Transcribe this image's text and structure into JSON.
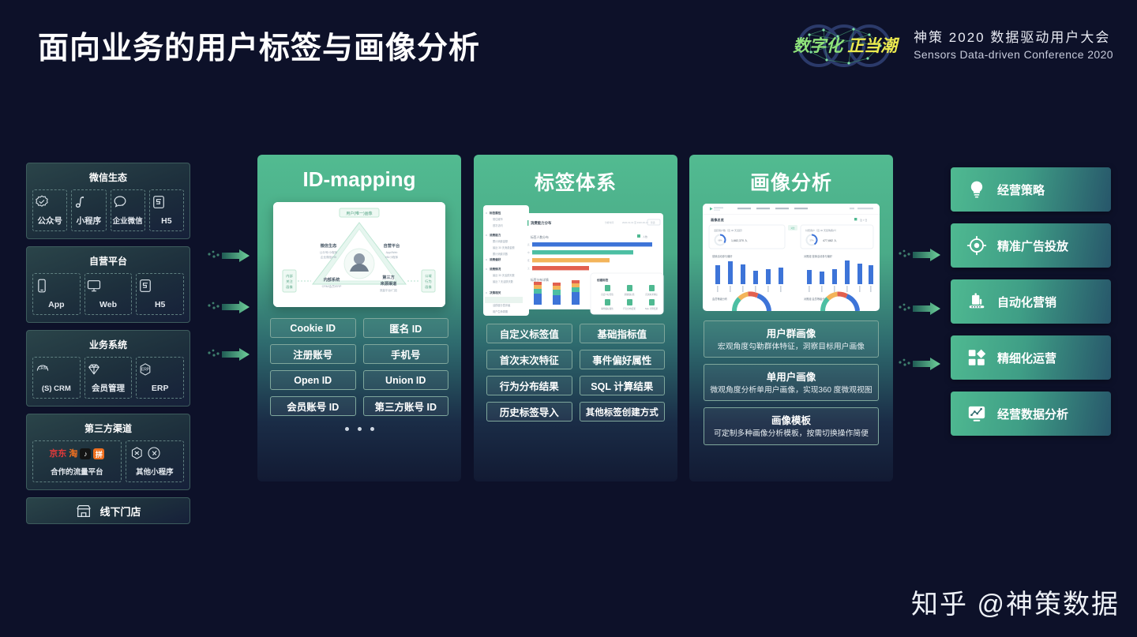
{
  "header": {
    "title": "面向业务的用户标签与画像分析",
    "brand": {
      "slogan_1": "数字化",
      "slogan_2": "正当潮",
      "conference_cn": "神策 2020 数据驱动用户大会",
      "conference_en": "Sensors Data-driven Conference 2020",
      "slogan_1_color": "#8fe37a",
      "slogan_2_color": "#ecea4e"
    }
  },
  "sources": {
    "groups": [
      {
        "title": "微信生态",
        "items": [
          {
            "label": "公众号",
            "icon": "verified-badge-icon"
          },
          {
            "label": "小程序",
            "icon": "mini-program-icon"
          },
          {
            "label": "企业微信",
            "icon": "chat-bubble-icon"
          },
          {
            "label": "H5",
            "icon": "html5-icon"
          }
        ]
      },
      {
        "title": "自营平台",
        "items": [
          {
            "label": "App",
            "icon": "mobile-phone-icon"
          },
          {
            "label": "Web",
            "icon": "desktop-monitor-icon"
          },
          {
            "label": "H5",
            "icon": "html5-icon"
          }
        ]
      },
      {
        "title": "业务系统",
        "items": [
          {
            "label": "(S) CRM",
            "icon": "crm-icon"
          },
          {
            "label": "会员管理",
            "icon": "diamond-icon"
          },
          {
            "label": "ERP",
            "icon": "erp-icon"
          }
        ]
      },
      {
        "title": "第三方渠道",
        "items": [
          {
            "label": "合作的流量平台",
            "icon": "partner-logos-icon"
          },
          {
            "label": "其他小程序",
            "icon": "other-mini-program-icon"
          }
        ]
      }
    ],
    "offline": {
      "label": "线下门店",
      "icon": "storefront-icon"
    }
  },
  "panels": [
    {
      "title": "ID-mapping",
      "diagram": {
        "top_node": "用户 (唯一) 画像",
        "nodes": [
          "微信生态",
          "自营平台",
          "内部系统",
          "第三方来源渠道"
        ],
        "side_left": "内部\n关注\n画像",
        "side_right": "公域\n行为\n画像"
      },
      "tags": [
        "Cookie ID",
        "匿名 ID",
        "注册账号",
        "手机号",
        "Open ID",
        "Union ID",
        "会员账号 ID",
        "第三方账号 ID"
      ],
      "pagination_dots": 3
    },
    {
      "title": "标签体系",
      "tags": [
        "自定义标签值",
        "基础指标值",
        "首次末次特征",
        "事件偏好属性",
        "行为分布结果",
        "SQL 计算结果",
        "历史标签导入",
        "其他标签创建方式"
      ]
    },
    {
      "title": "画像分析",
      "cards": [
        {
          "title": "用户群画像",
          "desc": "宏观角度勾勒群体特征，洞察目标用户画像"
        },
        {
          "title": "单用户画像",
          "desc": "微观角度分析单用户画像，实现360 度微观视图"
        },
        {
          "title": "画像模板",
          "desc": "可定制多种画像分析模板，按需切换操作简便"
        }
      ]
    }
  ],
  "outcomes": [
    {
      "label": "经营策略",
      "icon": "lightbulb-icon"
    },
    {
      "label": "精准广告投放",
      "icon": "target-icon"
    },
    {
      "label": "自动化营销",
      "icon": "automation-machine-icon"
    },
    {
      "label": "精细化运营",
      "icon": "grid-blocks-icon"
    },
    {
      "label": "经营数据分析",
      "icon": "chart-analysis-icon"
    }
  ],
  "watermark": "知乎 @神策数据",
  "theme": {
    "background": "#0d1129",
    "accent_green": "#4fb991",
    "panel_green": "#52bb91",
    "arrow_green": "#5fbf8e"
  }
}
